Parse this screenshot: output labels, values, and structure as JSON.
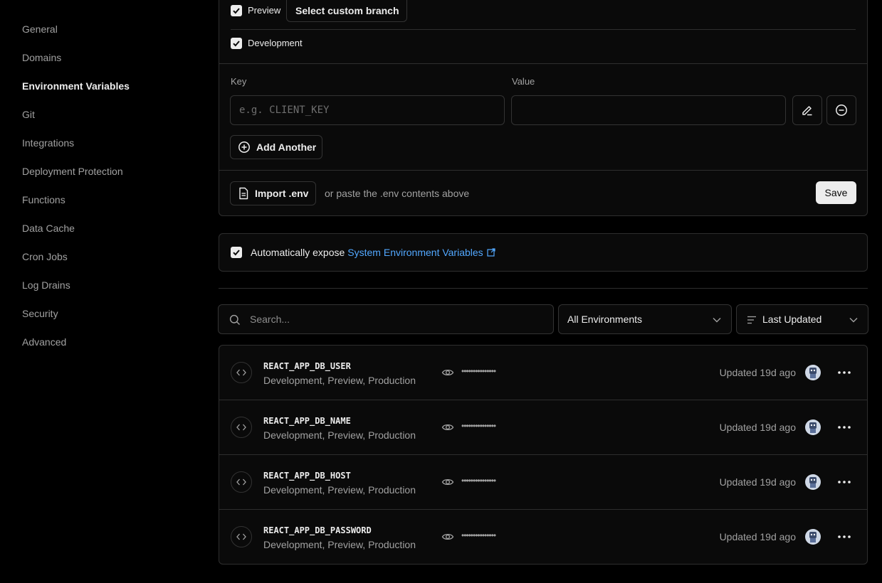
{
  "sidebar": {
    "items": [
      {
        "label": "General",
        "active": false
      },
      {
        "label": "Domains",
        "active": false
      },
      {
        "label": "Environment Variables",
        "active": true
      },
      {
        "label": "Git",
        "active": false
      },
      {
        "label": "Integrations",
        "active": false
      },
      {
        "label": "Deployment Protection",
        "active": false
      },
      {
        "label": "Functions",
        "active": false
      },
      {
        "label": "Data Cache",
        "active": false
      },
      {
        "label": "Cron Jobs",
        "active": false
      },
      {
        "label": "Log Drains",
        "active": false
      },
      {
        "label": "Security",
        "active": false
      },
      {
        "label": "Advanced",
        "active": false
      }
    ]
  },
  "form": {
    "preview_label": "Preview",
    "preview_checked": true,
    "select_branch_label": "Select custom branch",
    "development_label": "Development",
    "development_checked": true,
    "key_label": "Key",
    "key_placeholder": "e.g. CLIENT_KEY",
    "key_value": "",
    "value_label": "Value",
    "value_value": "",
    "add_another_label": "Add Another",
    "import_label": "Import .env",
    "paste_hint": "or paste the .env contents above",
    "save_label": "Save"
  },
  "expose": {
    "checked": true,
    "text": "Automatically expose",
    "link_text": "System Environment Variables"
  },
  "filters": {
    "search_placeholder": "Search...",
    "environment_selected": "All Environments",
    "sort_selected": "Last Updated"
  },
  "variables": [
    {
      "key": "REACT_APP_DB_USER",
      "environments": "Development, Preview, Production",
      "masked": "•••••••••••••••",
      "updated": "Updated 19d ago"
    },
    {
      "key": "REACT_APP_DB_NAME",
      "environments": "Development, Preview, Production",
      "masked": "•••••••••••••••",
      "updated": "Updated 19d ago"
    },
    {
      "key": "REACT_APP_DB_HOST",
      "environments": "Development, Preview, Production",
      "masked": "•••••••••••••••",
      "updated": "Updated 19d ago"
    },
    {
      "key": "REACT_APP_DB_PASSWORD",
      "environments": "Development, Preview, Production",
      "masked": "•••••••••••••••",
      "updated": "Updated 19d ago"
    }
  ],
  "colors": {
    "background": "#000000",
    "panel": "#0a0a0a",
    "border": "#2e2e2e",
    "text": "#ededed",
    "muted": "#a1a1a1",
    "link": "#52a8ff"
  }
}
